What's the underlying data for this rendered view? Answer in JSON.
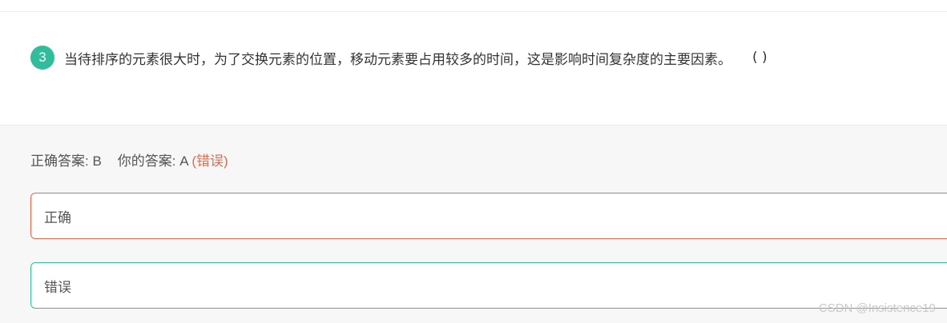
{
  "question": {
    "number": "3",
    "text": "当待排序的元素很大时，为了交换元素的位置，移动元素要占用较多的时间，这是影响时间复杂度的主要因素。",
    "blank": "( )"
  },
  "answer_summary": {
    "correct_label": "正确答案: B",
    "your_label": "你的答案: A",
    "result": "(错误)"
  },
  "options": [
    {
      "label": "正确",
      "state": "wrong-selected",
      "border_color": "#e8694a"
    },
    {
      "label": "错误",
      "state": "correct",
      "border_color": "#2fbd9b"
    }
  ],
  "colors": {
    "accent": "#2fbd9b",
    "error": "#e8694a"
  },
  "watermark": "CSDN @Insistence19"
}
